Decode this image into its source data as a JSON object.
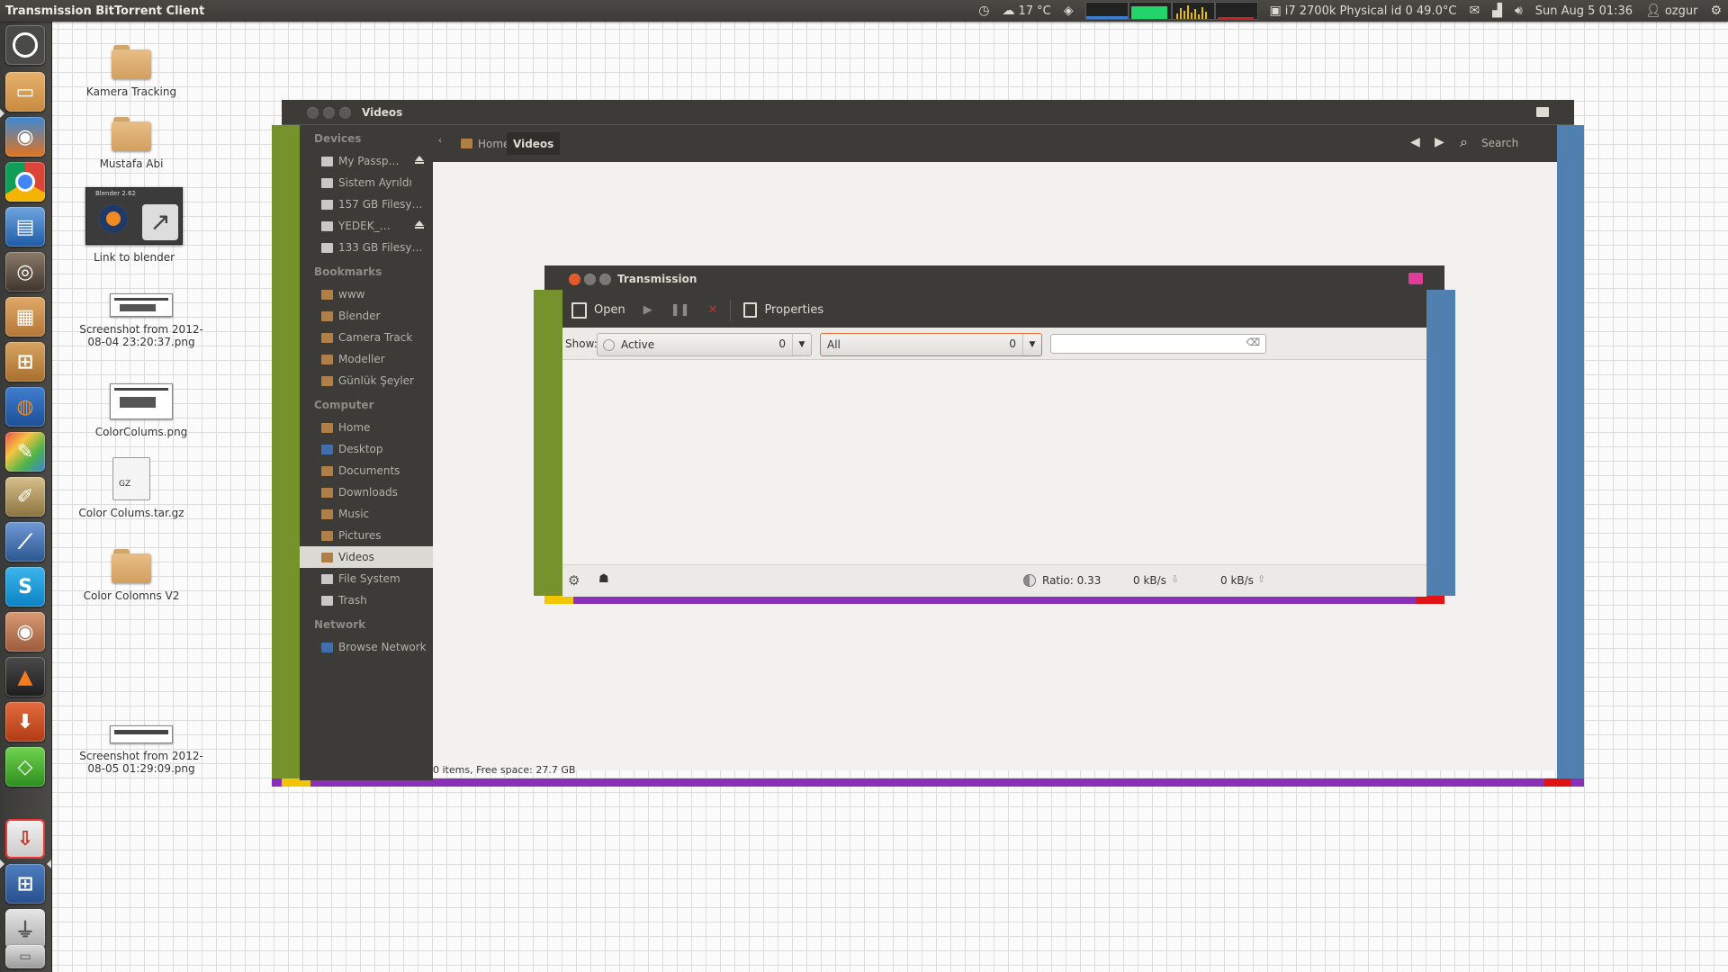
{
  "top_panel": {
    "app_title": "Transmission BitTorrent Client",
    "weather": "17 °C",
    "cpu_temp": "i7 2700k Physical id 0 49.0°C",
    "datetime": "Sun Aug  5 01:36",
    "user": "ozgur"
  },
  "desktop": {
    "icons": [
      {
        "label": "Kamera Tracking"
      },
      {
        "label": "Mustafa Abi"
      },
      {
        "label": "Link to blender"
      },
      {
        "label": "Screenshot from 2012-08-04 23:20:37.png"
      },
      {
        "label": "ColorColums.png"
      },
      {
        "label": "Color Colums.tar.gz"
      },
      {
        "label": "Color Colomns V2"
      },
      {
        "label": "Screenshot from 2012-08-05 01:29:09.png"
      }
    ],
    "blender_badge": "Blender 2.62",
    "gz_badge": "GZ"
  },
  "nautilus": {
    "title": "Videos",
    "sidebar": {
      "devices_header": "Devices",
      "devices": [
        "My Passp…",
        "Sistem Ayrıldı",
        "157 GB Filesy…",
        "YEDEK_…",
        "133 GB Filesy…"
      ],
      "bookmarks_header": "Bookmarks",
      "bookmarks": [
        "www",
        "Blender",
        "Camera Track",
        "Modeller",
        "Günlük Şeyler"
      ],
      "computer_header": "Computer",
      "computer": [
        "Home",
        "Desktop",
        "Documents",
        "Downloads",
        "Music",
        "Pictures",
        "Videos",
        "File System",
        "Trash"
      ],
      "network_header": "Network",
      "network": [
        "Browse Network"
      ]
    },
    "breadcrumb": {
      "home": "Home",
      "current": "Videos"
    },
    "search_label": "Search",
    "status": "0 items, Free space: 27.7 GB"
  },
  "transmission": {
    "title": "Transmission",
    "toolbar": {
      "open": "Open",
      "properties": "Properties"
    },
    "filter": {
      "show_label": "Show:",
      "activity": "Active",
      "activity_count": "0",
      "tracker": "All",
      "tracker_count": "0"
    },
    "status": {
      "ratio": "Ratio: 0.33",
      "down": "0 kB/s",
      "up": "0 kB/s"
    }
  },
  "colors": {
    "green": "#76922c",
    "blue": "#4f80b0",
    "purple": "#8a2fb8",
    "yellow": "#f2c500",
    "red": "#e01414",
    "panel": "#3c3b37"
  }
}
